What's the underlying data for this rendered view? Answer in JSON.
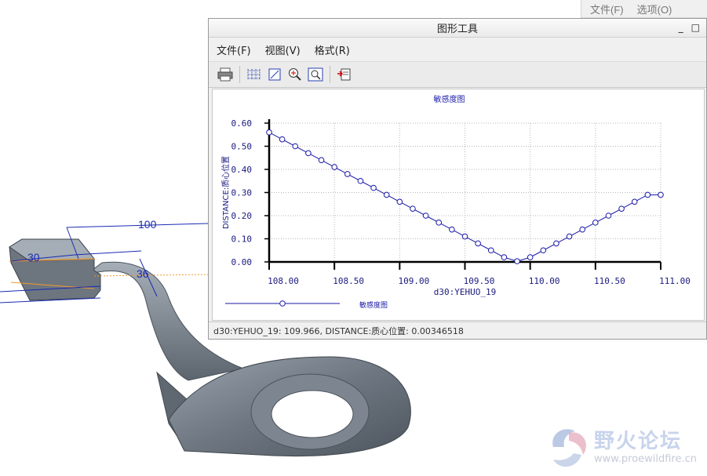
{
  "background_window": {
    "menu": [
      "文件(F)",
      "选项(O)"
    ]
  },
  "model": {
    "dimensions": [
      "100",
      "30",
      "36"
    ]
  },
  "graph_window": {
    "title": "图形工具",
    "controls": [
      "_",
      "□"
    ],
    "menu": [
      "文件(F)",
      "视图(V)",
      "格式(R)"
    ],
    "toolbar_icons": [
      "print-icon",
      "grid-icon",
      "axis-icon",
      "zoom-in-icon",
      "zoom-fit-icon",
      "export-icon"
    ],
    "status": "d30:YEHUO_19: 109.966, DISTANCE:质心位置: 0.00346518"
  },
  "chart_data": {
    "type": "line",
    "title": "敏感度图",
    "xlabel": "d30:YEHUO_19",
    "ylabel": "DISTANCE:质心位置",
    "xlim": [
      108.0,
      111.0
    ],
    "ylim": [
      0.0,
      0.6
    ],
    "x_ticks": [
      "108.00",
      "108.50",
      "109.00",
      "109.50",
      "110.00",
      "110.50",
      "111.00"
    ],
    "y_ticks": [
      "0.00",
      "0.10",
      "0.20",
      "0.30",
      "0.40",
      "0.50",
      "0.60"
    ],
    "grid": true,
    "legend": {
      "position": "bottom-left",
      "entries": [
        "敏感度图"
      ]
    },
    "colors": {
      "series": "#1a1aa8"
    },
    "series": [
      {
        "x": [
          108.0,
          108.1,
          108.2,
          108.3,
          108.4,
          108.5,
          108.6,
          108.7,
          108.8,
          108.9,
          109.0,
          109.1,
          109.2,
          109.3,
          109.4,
          109.5,
          109.6,
          109.7,
          109.8,
          109.9,
          110.0,
          110.1,
          110.2,
          110.3,
          110.4,
          110.5,
          110.6,
          110.7,
          110.8,
          110.9,
          111.0
        ],
        "y": [
          0.56,
          0.53,
          0.5,
          0.47,
          0.44,
          0.41,
          0.38,
          0.35,
          0.32,
          0.29,
          0.26,
          0.23,
          0.2,
          0.17,
          0.14,
          0.11,
          0.08,
          0.05,
          0.02,
          0.003,
          0.02,
          0.05,
          0.08,
          0.11,
          0.14,
          0.17,
          0.2,
          0.23,
          0.26,
          0.29,
          0.29
        ]
      }
    ]
  },
  "watermark": {
    "text": "野火论坛",
    "url": "www.proewildfire.cn"
  }
}
